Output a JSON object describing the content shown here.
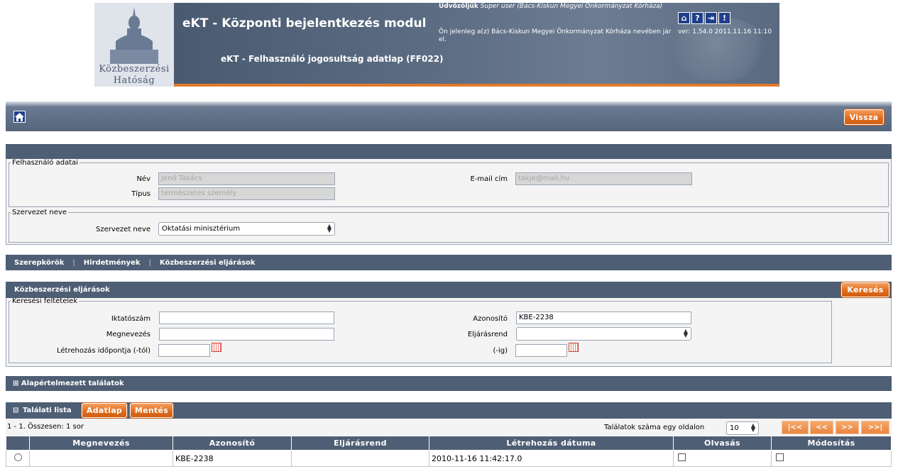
{
  "header": {
    "logo_line1": "Közbeszerzési",
    "logo_line2": "Hatóság",
    "app_title": "eKT - Központi bejelentkezés modul",
    "page_subtitle": "eKT - Felhasználó jogosultság adatlap (FF022)",
    "welcome_label": "Üdvözöljük",
    "welcome_user": "Super user (Bács-Kiskun Megyei Önkormányzat Kórháza)",
    "acting_as": "Ön jelenleg a(z) Bács-Kiskun Megyei Önkormányzat Kórháza nevében jár el.",
    "version": "ver: 1.54.0 2011.11.16 11:10",
    "icons": [
      "home-icon",
      "help-icon",
      "logout-icon",
      "alert-icon"
    ],
    "icon_glyphs": [
      "⌂",
      "?",
      "⇥",
      "!"
    ]
  },
  "nav": {
    "back_label": "Vissza"
  },
  "user_panel": {
    "legend": "Felhasználó adatai",
    "name_label": "Név",
    "name_value": "Jenő Takács",
    "type_label": "Típus",
    "type_value": "természetes személy",
    "email_label": "E-mail cím",
    "email_value": "takje@mail.hu"
  },
  "org_panel": {
    "legend": "Szervezet neve",
    "org_label": "Szervezet neve",
    "org_value": "Oktatási minisztérium"
  },
  "tabs": [
    "Szerepkörök",
    "Hirdetmények",
    "Közbeszerzési eljárások"
  ],
  "search_panel": {
    "title": "Közbeszerzési eljárások",
    "search_button": "Keresés",
    "legend": "Keresési feltételek",
    "iktatoszam_label": "Iktatószám",
    "iktatoszam_value": "",
    "megnevezes_label": "Megnevezés",
    "megnevezes_value": "",
    "created_from_label": "Létrehozás időpontja (-tól)",
    "created_from_value": "",
    "azonosito_label": "Azonosító",
    "azonosito_value": "KBE-2238",
    "eljarasrend_label": "Eljárásrend",
    "eljarasrend_value": "",
    "created_to_label": "(-ig)",
    "created_to_value": ""
  },
  "default_results": {
    "toggle": "⊞",
    "title": "Alapértelmezett találatok"
  },
  "results": {
    "toggle": "⊟",
    "title": "Találati lista",
    "datasheet_button": "Adatlap",
    "save_button": "Mentés",
    "summary": "1 - 1. Összesen: 1 sor",
    "per_page_label": "Találatok száma egy oldalon",
    "per_page_value": "10",
    "pager": [
      "|<<",
      "<<",
      ">>",
      ">>|"
    ],
    "columns": [
      "Megnevezés",
      "Azonosító",
      "Eljárásrend",
      "Létrehozás dátuma",
      "Olvasás",
      "Módosítás"
    ],
    "rows": [
      {
        "megnevezes": "",
        "azonosito": "KBE-2238",
        "eljarasrend": "",
        "letrehozas": "2010-11-16 11:42:17.0",
        "olvasas": false,
        "modositas": false
      }
    ]
  }
}
